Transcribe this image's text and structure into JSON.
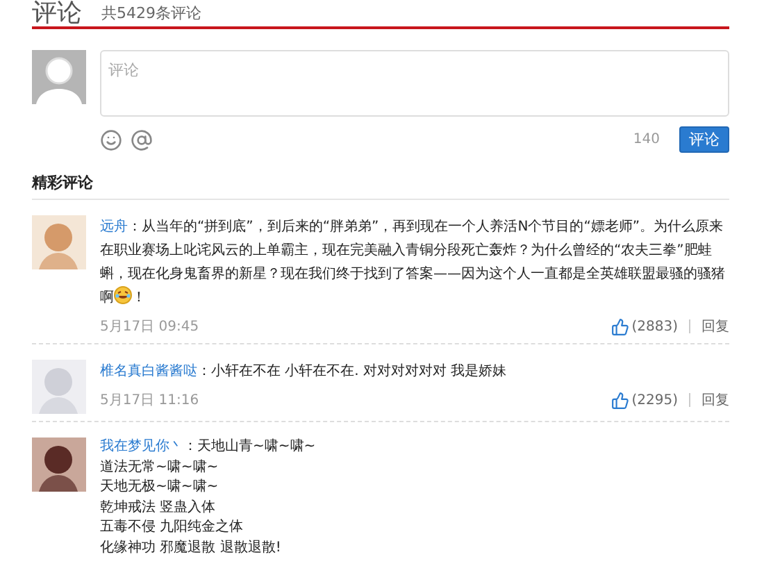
{
  "header": {
    "title": "评论",
    "count": "共5429条评论"
  },
  "composer": {
    "placeholder": "评论",
    "remaining": "140",
    "submit": "评论"
  },
  "section_title": "精彩评论",
  "comments": [
    {
      "author": "远舟",
      "body": "：从当年的“拼到底”，到后来的“胖弟弟”，再到现在一个人养活N个节目的“嫖老师”。为什么原来在职业赛场上叱诧风云的上单霸主，现在完美融入青铜分段死亡轰炸？为什么曾经的“农夫三拳”肥蛙蝌，现在化身鬼畜界的新星？现在我们终于找到了答案——因为这个人一直都是全英雄联盟最骚的骚猪啊",
      "emoji": true,
      "tail": "！",
      "time": "5月17日 09:45",
      "likes": "(2883)",
      "reply": "回复"
    },
    {
      "author": "椎名真白酱酱哒",
      "body": "：小轩在不在 小轩在不在. 对对对对对对 我是娇妹",
      "time": "5月17日 11:16",
      "likes": "(2295)",
      "reply": "回复"
    },
    {
      "author": "我在梦见你丶",
      "body": "：天地山青~啸~啸~",
      "lines": [
        "道法无常~啸~啸~",
        "天地无极~啸~啸~",
        "乾坤戒法 竖蛊入体",
        "五毒不侵 九阳纯金之体",
        "化缘神功 邪魔退散 退散退散!"
      ]
    }
  ]
}
